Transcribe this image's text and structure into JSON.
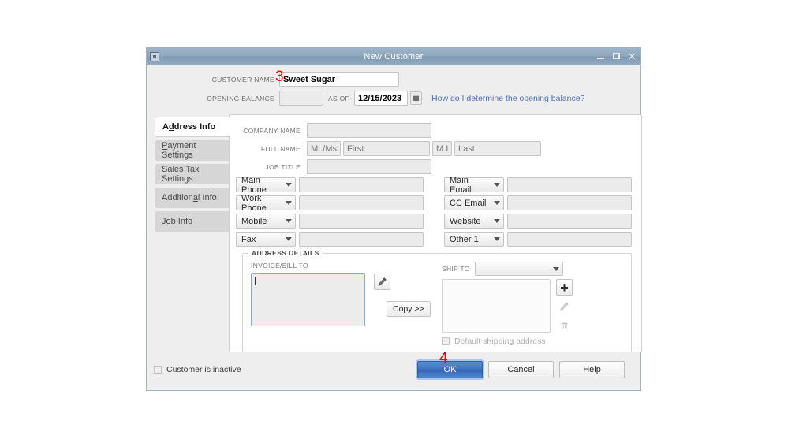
{
  "window": {
    "title": "New Customer",
    "sysmenu_icon": "system-menu-icon",
    "minimize_icon": "minimize-icon",
    "maximize_icon": "maximize-icon",
    "close_icon": "close-icon"
  },
  "header": {
    "customer_name_label": "CUSTOMER NAME",
    "customer_name_value": "Sweet Sugar",
    "opening_balance_label": "OPENING BALANCE",
    "opening_balance_value": "",
    "as_of_label": "AS OF",
    "as_of_value": "12/15/2023",
    "calendar_icon": "calendar-icon",
    "help_link": "How do I determine the opening balance?"
  },
  "annotations": [
    {
      "id": "3",
      "label": "3"
    },
    {
      "id": "4",
      "label": "4"
    }
  ],
  "tabs": [
    {
      "label": "Address Info",
      "mnemonic": "d",
      "active": true
    },
    {
      "label": "Payment Settings",
      "mnemonic": "P",
      "active": false
    },
    {
      "label": "Sales Tax Settings",
      "mnemonic": "T",
      "active": false
    },
    {
      "label": "Additional Info",
      "mnemonic": "a",
      "active": false
    },
    {
      "label": "Job Info",
      "mnemonic": "J",
      "active": false
    }
  ],
  "form": {
    "company_name_label": "COMPANY NAME",
    "company_name_value": "",
    "full_name_label": "FULL NAME",
    "salutation_placeholder": "Mr./Ms./...",
    "first_placeholder": "First",
    "mi_placeholder": "M.I.",
    "last_placeholder": "Last",
    "job_title_label": "JOB TITLE",
    "job_title_value": "",
    "contact_rows": [
      {
        "left_type": "Main Phone",
        "left_value": "",
        "right_type": "Main Email",
        "right_value": ""
      },
      {
        "left_type": "Work Phone",
        "left_value": "",
        "right_type": "CC Email",
        "right_value": ""
      },
      {
        "left_type": "Mobile",
        "left_value": "",
        "right_type": "Website",
        "right_value": ""
      },
      {
        "left_type": "Fax",
        "left_value": "",
        "right_type": "Other 1",
        "right_value": ""
      }
    ]
  },
  "address_details": {
    "group_title": "ADDRESS DETAILS",
    "invoice_bill_to_label": "INVOICE/BILL TO",
    "invoice_bill_to_value": "",
    "edit_invoice_icon": "pencil-icon",
    "copy_button": "Copy >>",
    "ship_to_label": "SHIP TO",
    "ship_to_value": "",
    "ship_to_textarea_value": "",
    "add_ship_icon": "plus-icon",
    "edit_ship_icon": "pencil-icon",
    "delete_ship_icon": "trash-icon",
    "default_shipping_label": "Default shipping address"
  },
  "footer": {
    "inactive_label": "Customer is inactive",
    "ok_label": "OK",
    "cancel_label": "Cancel",
    "help_label": "Help"
  },
  "colors": {
    "titlebar": "#8fa8bd",
    "ok_button": "#3f6fc0",
    "link": "#4d6fb5",
    "annotation": "#ee0000",
    "dialog_bg": "#eeeeee"
  }
}
